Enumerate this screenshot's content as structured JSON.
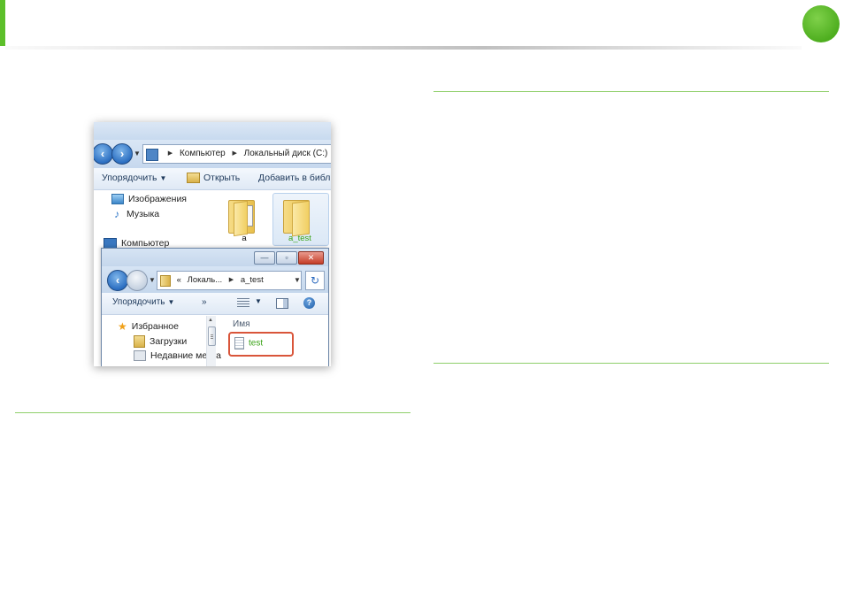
{
  "colors": {
    "accent": "#5cbf2a",
    "rule": "#8fcf6a",
    "highlight_border": "#d9553a",
    "file_label": "#3aa317"
  },
  "background_window": {
    "address_segments": [
      "Компьютер",
      "Локальный диск (C:)"
    ],
    "toolbar": {
      "organize": "Упорядочить",
      "open": "Открыть",
      "add_to_library": "Добавить в библи"
    },
    "nav_pane": [
      "Изображения",
      "Музыка",
      "Компьютер"
    ],
    "folders": [
      {
        "name": "a"
      },
      {
        "name": "a_test",
        "selected": true
      }
    ]
  },
  "foreground_window": {
    "title_buttons": {
      "minimize": "—",
      "maximize": "▫",
      "close": "✕"
    },
    "address": {
      "prefix": "«",
      "segments": [
        "Локаль...",
        "a_test"
      ]
    },
    "toolbar": {
      "organize": "Упорядочить",
      "more": "»"
    },
    "nav_pane": [
      "Избранное",
      "Загрузки",
      "Недавние места"
    ],
    "column_header": "Имя",
    "files": [
      {
        "name": "test",
        "highlighted": true
      }
    ]
  }
}
